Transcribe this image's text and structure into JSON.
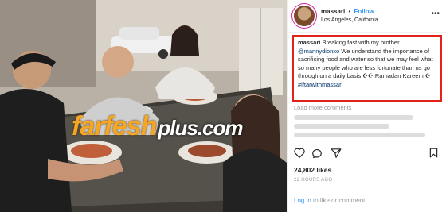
{
  "header": {
    "username": "massari",
    "separator": "•",
    "follow_label": "Follow",
    "location": "Los Angeles, California",
    "more_icon": "more-horizontal-icon"
  },
  "caption": {
    "username": "massari",
    "text_1": "Breaking fast with my brother",
    "mention": "@mannydionxo",
    "text_2": "We understand the importance of sacrificing food and water so that we may feel what so many people who are less fortunate than us go through on a daily basis",
    "emoji": "☪☪",
    "text_3": "Ramadan Kareem",
    "emoji2": "☪",
    "hashtag": "#iftarwithmassari",
    "border_color": "#e2231a"
  },
  "comments": {
    "load_more_label": "Load more comments"
  },
  "actions": {
    "like_icon": "heart-icon",
    "comment_icon": "comment-icon",
    "share_icon": "share-icon",
    "save_icon": "bookmark-icon"
  },
  "likes": "24,802 likes",
  "timestamp": "22 HOURS AGO",
  "footer": {
    "login_label": "Log in",
    "rest": "to like or comment."
  },
  "watermark": {
    "main": "farfesh",
    "suffix": "plus.com"
  },
  "colors": {
    "follow": "#3897f0",
    "watermark": "#f5a623"
  }
}
